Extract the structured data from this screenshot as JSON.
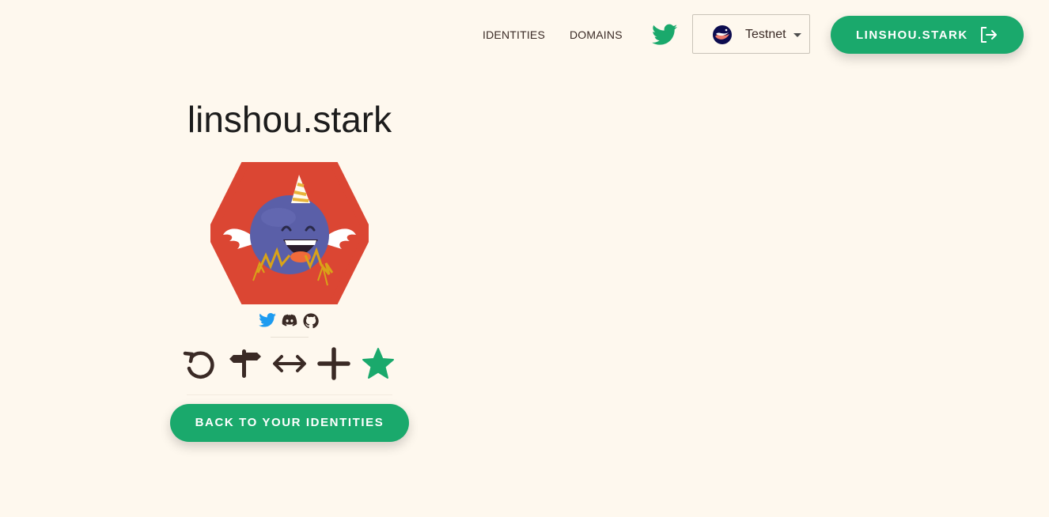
{
  "nav": {
    "identities_label": "IDENTITIES",
    "domains_label": "DOMAINS",
    "twitter_icon": "twitter-icon",
    "network": {
      "selected": "Testnet",
      "icon": "starknet-logo-icon"
    },
    "wallet_button": {
      "label": "LINSHOU.STARK",
      "icon": "logout-icon"
    }
  },
  "identity": {
    "name": "linshou.stark",
    "avatar": "unicorn-bird-avatar",
    "socials": [
      {
        "icon": "twitter-icon"
      },
      {
        "icon": "discord-icon"
      },
      {
        "icon": "github-icon"
      }
    ],
    "actions": [
      {
        "icon": "renew-icon"
      },
      {
        "icon": "signpost-icon"
      },
      {
        "icon": "transfer-arrows-icon"
      },
      {
        "icon": "plus-icon"
      },
      {
        "icon": "star-icon"
      }
    ],
    "back_button_label": "BACK TO YOUR IDENTITIES"
  },
  "colors": {
    "background": "#fef8ee",
    "accent_green": "#1aa96c",
    "text_dark": "#3a2a25",
    "avatar_bg": "#db4633",
    "twitter_blue": "#1d9bf0"
  }
}
